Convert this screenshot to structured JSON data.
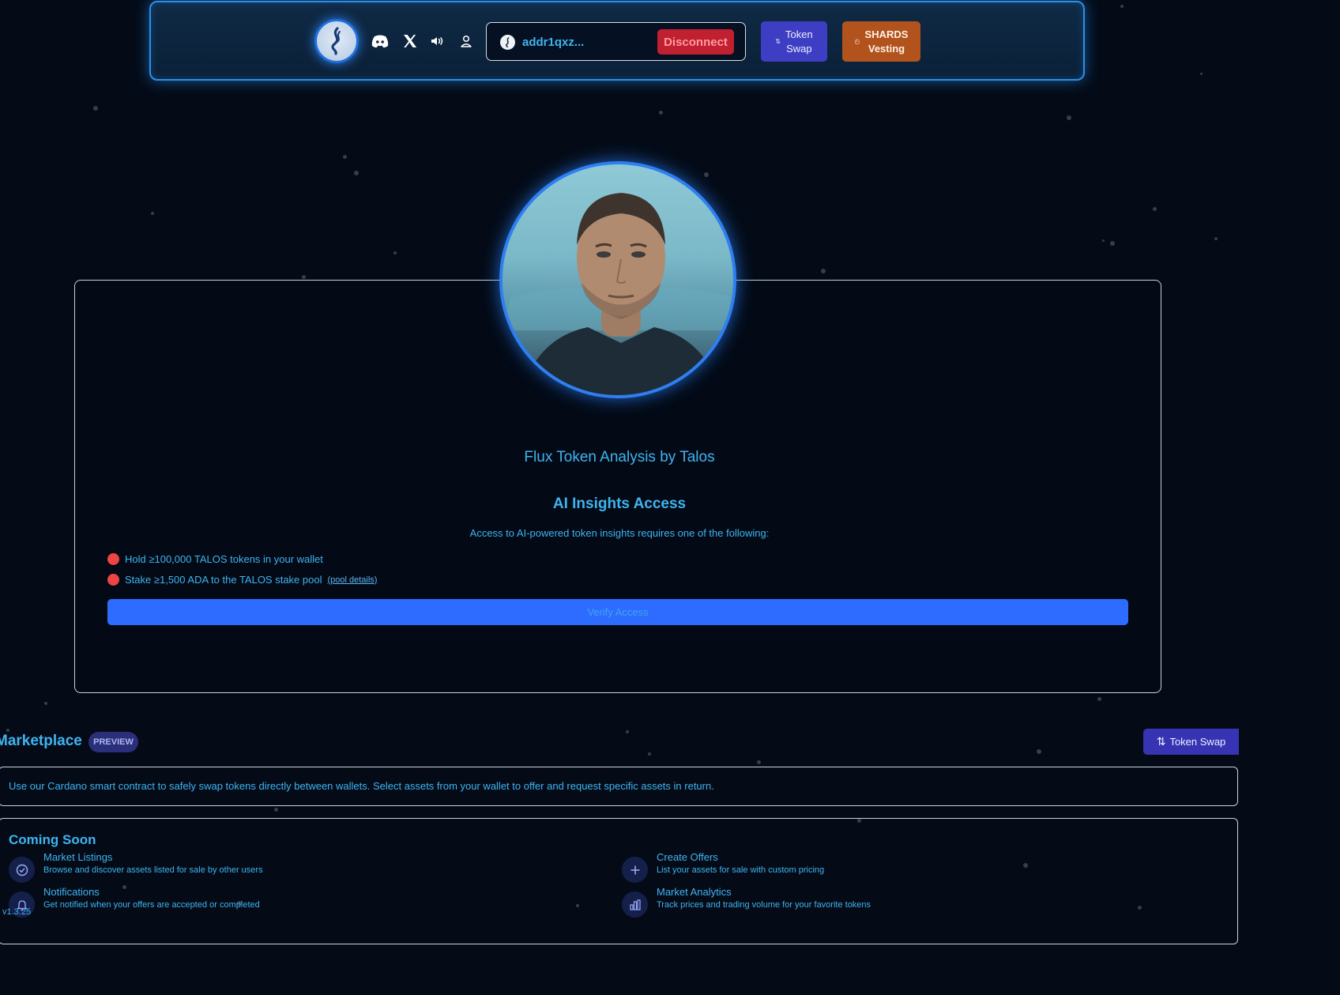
{
  "header": {
    "wallet_address": "addr1qxz...",
    "disconnect_label": "Disconnect",
    "token_swap_label_line1": "Token",
    "token_swap_label_line2": "Swap",
    "shards_label_line1": "SHARDS",
    "shards_label_line2": "Vesting",
    "icons": [
      "talos-logo-icon",
      "discord-icon",
      "x-icon",
      "speaker-icon",
      "user-icon",
      "wallet-icon"
    ]
  },
  "panel": {
    "title": "Flux Token Analysis by Talos",
    "access_heading": "AI Insights Access",
    "access_description": "Access to AI-powered token insights requires one of the following:",
    "requirements": [
      {
        "text": "Hold ≥100,000 TALOS tokens in your wallet",
        "status": "unmet"
      },
      {
        "text": "Stake ≥1,500 ADA to the TALOS stake pool",
        "status": "unmet",
        "link": "(pool details)"
      }
    ],
    "verify_label": "Verify Access"
  },
  "marketplace": {
    "title": "Marketplace",
    "badge": "PREVIEW",
    "token_swap_label": "Token Swap",
    "description": "Use our Cardano smart contract to safely swap tokens directly between wallets. Select assets from your wallet to offer and request specific assets in return.",
    "coming_soon_title": "Coming Soon",
    "features": [
      {
        "name": "Market Listings",
        "desc": "Browse and discover assets listed for sale by other users",
        "icon": "check-circle-icon"
      },
      {
        "name": "Create Offers",
        "desc": "List your assets for sale with custom pricing",
        "icon": "plus-icon"
      },
      {
        "name": "Notifications",
        "desc": "Get notified when your offers are accepted or completed",
        "icon": "bell-icon"
      },
      {
        "name": "Market Analytics",
        "desc": "Track prices and trading volume for your favorite tokens",
        "icon": "bar-chart-icon"
      }
    ]
  },
  "version": "v1.3.25",
  "colors": {
    "background": "#040b17",
    "accent_text": "#3fb4f0",
    "disconnect": "#c0202f",
    "token_swap": "#3e3ec4",
    "shards": "#b2531e",
    "verify": "#2e6bff",
    "unmet_dot": "#ef4444"
  }
}
